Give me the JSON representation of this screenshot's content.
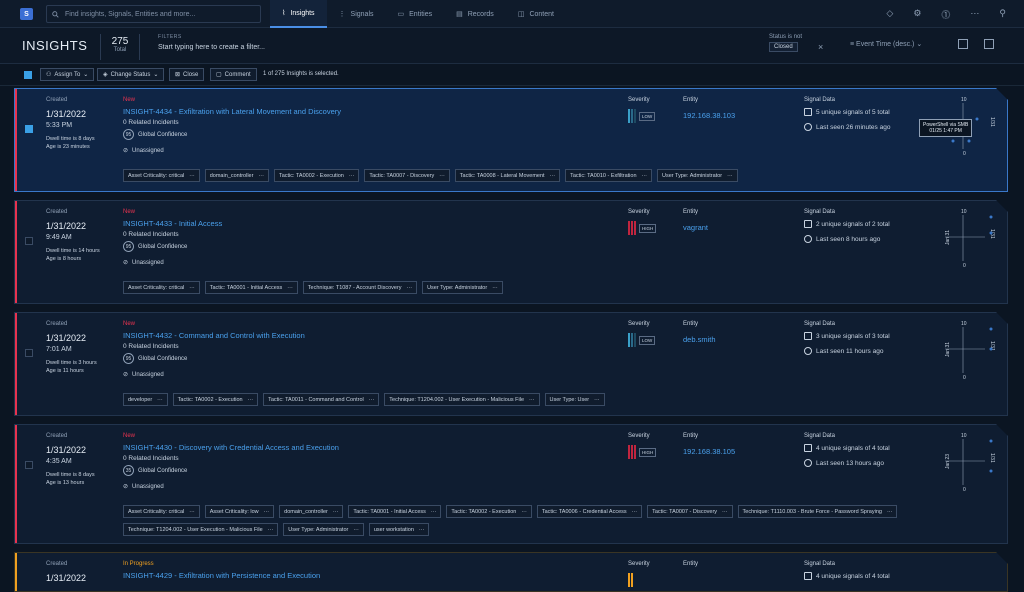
{
  "topbar": {
    "logo_text": "S",
    "search_placeholder": "Find insights, Signals, Entities and more...",
    "nav": [
      {
        "label": "Insights",
        "icon": "insights-icon",
        "active": true
      },
      {
        "label": "Signals",
        "icon": "signals-icon",
        "active": false
      },
      {
        "label": "Entities",
        "icon": "entities-icon",
        "active": false
      },
      {
        "label": "Records",
        "icon": "records-icon",
        "active": false
      },
      {
        "label": "Content",
        "icon": "content-icon",
        "active": false
      }
    ]
  },
  "header": {
    "title": "INSIGHTS",
    "count": "275",
    "count_label": "Total",
    "filters_label": "FILTERS",
    "filters_placeholder": "Start typing here to create a filter...",
    "status_label": "Status is not",
    "status_value": "Closed",
    "sort_label": "Event Time (desc.)"
  },
  "actions": {
    "assign": "Assign To",
    "change_status": "Change Status",
    "close": "Close",
    "comment": "Comment",
    "selection": "1 of 275 Insights is selected."
  },
  "labels": {
    "created": "Created",
    "severity": "Severity",
    "entity": "Entity",
    "signal_data": "Signal Data",
    "global_conf": "Global Confidence",
    "unassigned": "Unassigned"
  },
  "insights": [
    {
      "date": "1/31/2022",
      "time": "5:33 PM",
      "dwell": "Dwell time is 8 days",
      "age": "Age is 23 minutes",
      "state": "New",
      "title": "INSIGHT-4434 - Exfiltration with Lateral Movement and Discovery",
      "related": "0 Related Incidents",
      "confidence": "95",
      "severity": "LOW",
      "entity": "192.168.38.103",
      "signals": "5 unique signals of 5 total",
      "last_seen": "Last seen 26 minutes ago",
      "chart_top": "10",
      "chart_bottom": "0",
      "chart_left": "",
      "chart_right": "1/31",
      "tooltip_line1": "PowerShell via SMB",
      "tooltip_line2": "01/25 1:47 PM",
      "tags": [
        "Asset Criticality: critical",
        "domain_controller",
        "Tactic: TA0002 - Execution",
        "Tactic: TA0007 - Discovery",
        "Tactic: TA0008 - Lateral Movement",
        "Tactic: TA0010 - Exfiltration",
        "User Type: Administrator"
      ]
    },
    {
      "date": "1/31/2022",
      "time": "9:49 AM",
      "dwell": "Dwell time is 14 hours",
      "age": "Age is 8 hours",
      "state": "New",
      "title": "INSIGHT-4433 - Initial Access",
      "related": "0 Related Incidents",
      "confidence": "95",
      "severity": "HIGH",
      "entity": "vagrant",
      "signals": "2 unique signals of 2 total",
      "last_seen": "Last seen 8 hours ago",
      "chart_top": "10",
      "chart_bottom": "0",
      "chart_left": "Jan 31",
      "chart_right": "1/31",
      "tags": [
        "Asset Criticality: critical",
        "Tactic: TA0001 - Initial Access",
        "Technique: T1087 - Account Discovery",
        "User Type: Administrator"
      ]
    },
    {
      "date": "1/31/2022",
      "time": "7:01 AM",
      "dwell": "Dwell time is 3 hours",
      "age": "Age is 11 hours",
      "state": "New",
      "title": "INSIGHT-4432 - Command and Control with Execution",
      "related": "0 Related Incidents",
      "confidence": "95",
      "severity": "LOW",
      "entity": "deb.smith",
      "signals": "3 unique signals of 3 total",
      "last_seen": "Last seen 11 hours ago",
      "chart_top": "10",
      "chart_bottom": "0",
      "chart_left": "Jan 31",
      "chart_right": "1/31",
      "tags": [
        "developer",
        "Tactic: TA0002 - Execution",
        "Tactic: TA0011 - Command and Control",
        "Technique: T1204.002 - User Execution - Malicious File",
        "User Type: User"
      ]
    },
    {
      "date": "1/31/2022",
      "time": "4:35 AM",
      "dwell": "Dwell time is 8 days",
      "age": "Age is 13 hours",
      "state": "New",
      "title": "INSIGHT-4430 - Discovery with Credential Access and Execution",
      "related": "0 Related Incidents",
      "confidence": "35",
      "severity": "HIGH",
      "entity": "192.168.38.105",
      "signals": "4 unique signals of 4 total",
      "last_seen": "Last seen 13 hours ago",
      "chart_top": "10",
      "chart_bottom": "0",
      "chart_left": "Jan 23",
      "chart_right": "1/31",
      "tags": [
        "Asset Criticality: critical",
        "Asset Criticality: low",
        "domain_controller",
        "Tactic: TA0001 - Initial Access",
        "Tactic: TA0002 - Execution",
        "Tactic: TA0006 - Credential Access",
        "Tactic: TA0007 - Discovery",
        "Technique: T1110.003 - Brute Force - Password Spraying",
        "Technique: T1204.002 - User Execution - Malicious File",
        "User Type: Administrator",
        "user workstation"
      ]
    },
    {
      "date": "1/31/2022",
      "time": "",
      "dwell": "",
      "age": "",
      "state": "In Progress",
      "title": "INSIGHT-4429 - Exfiltration with Persistence and Execution",
      "related": "",
      "confidence": "",
      "severity": "",
      "entity": "",
      "signals": "4 unique signals of 4 total",
      "last_seen": "",
      "chart_top": "",
      "chart_bottom": "",
      "chart_left": "",
      "chart_right": "",
      "tags": []
    }
  ],
  "colors": {
    "accent": "#4aa0ec",
    "new": "#e8334f",
    "in_progress": "#f0a020",
    "low": "#3aa0c8",
    "high": "#c0253f"
  }
}
